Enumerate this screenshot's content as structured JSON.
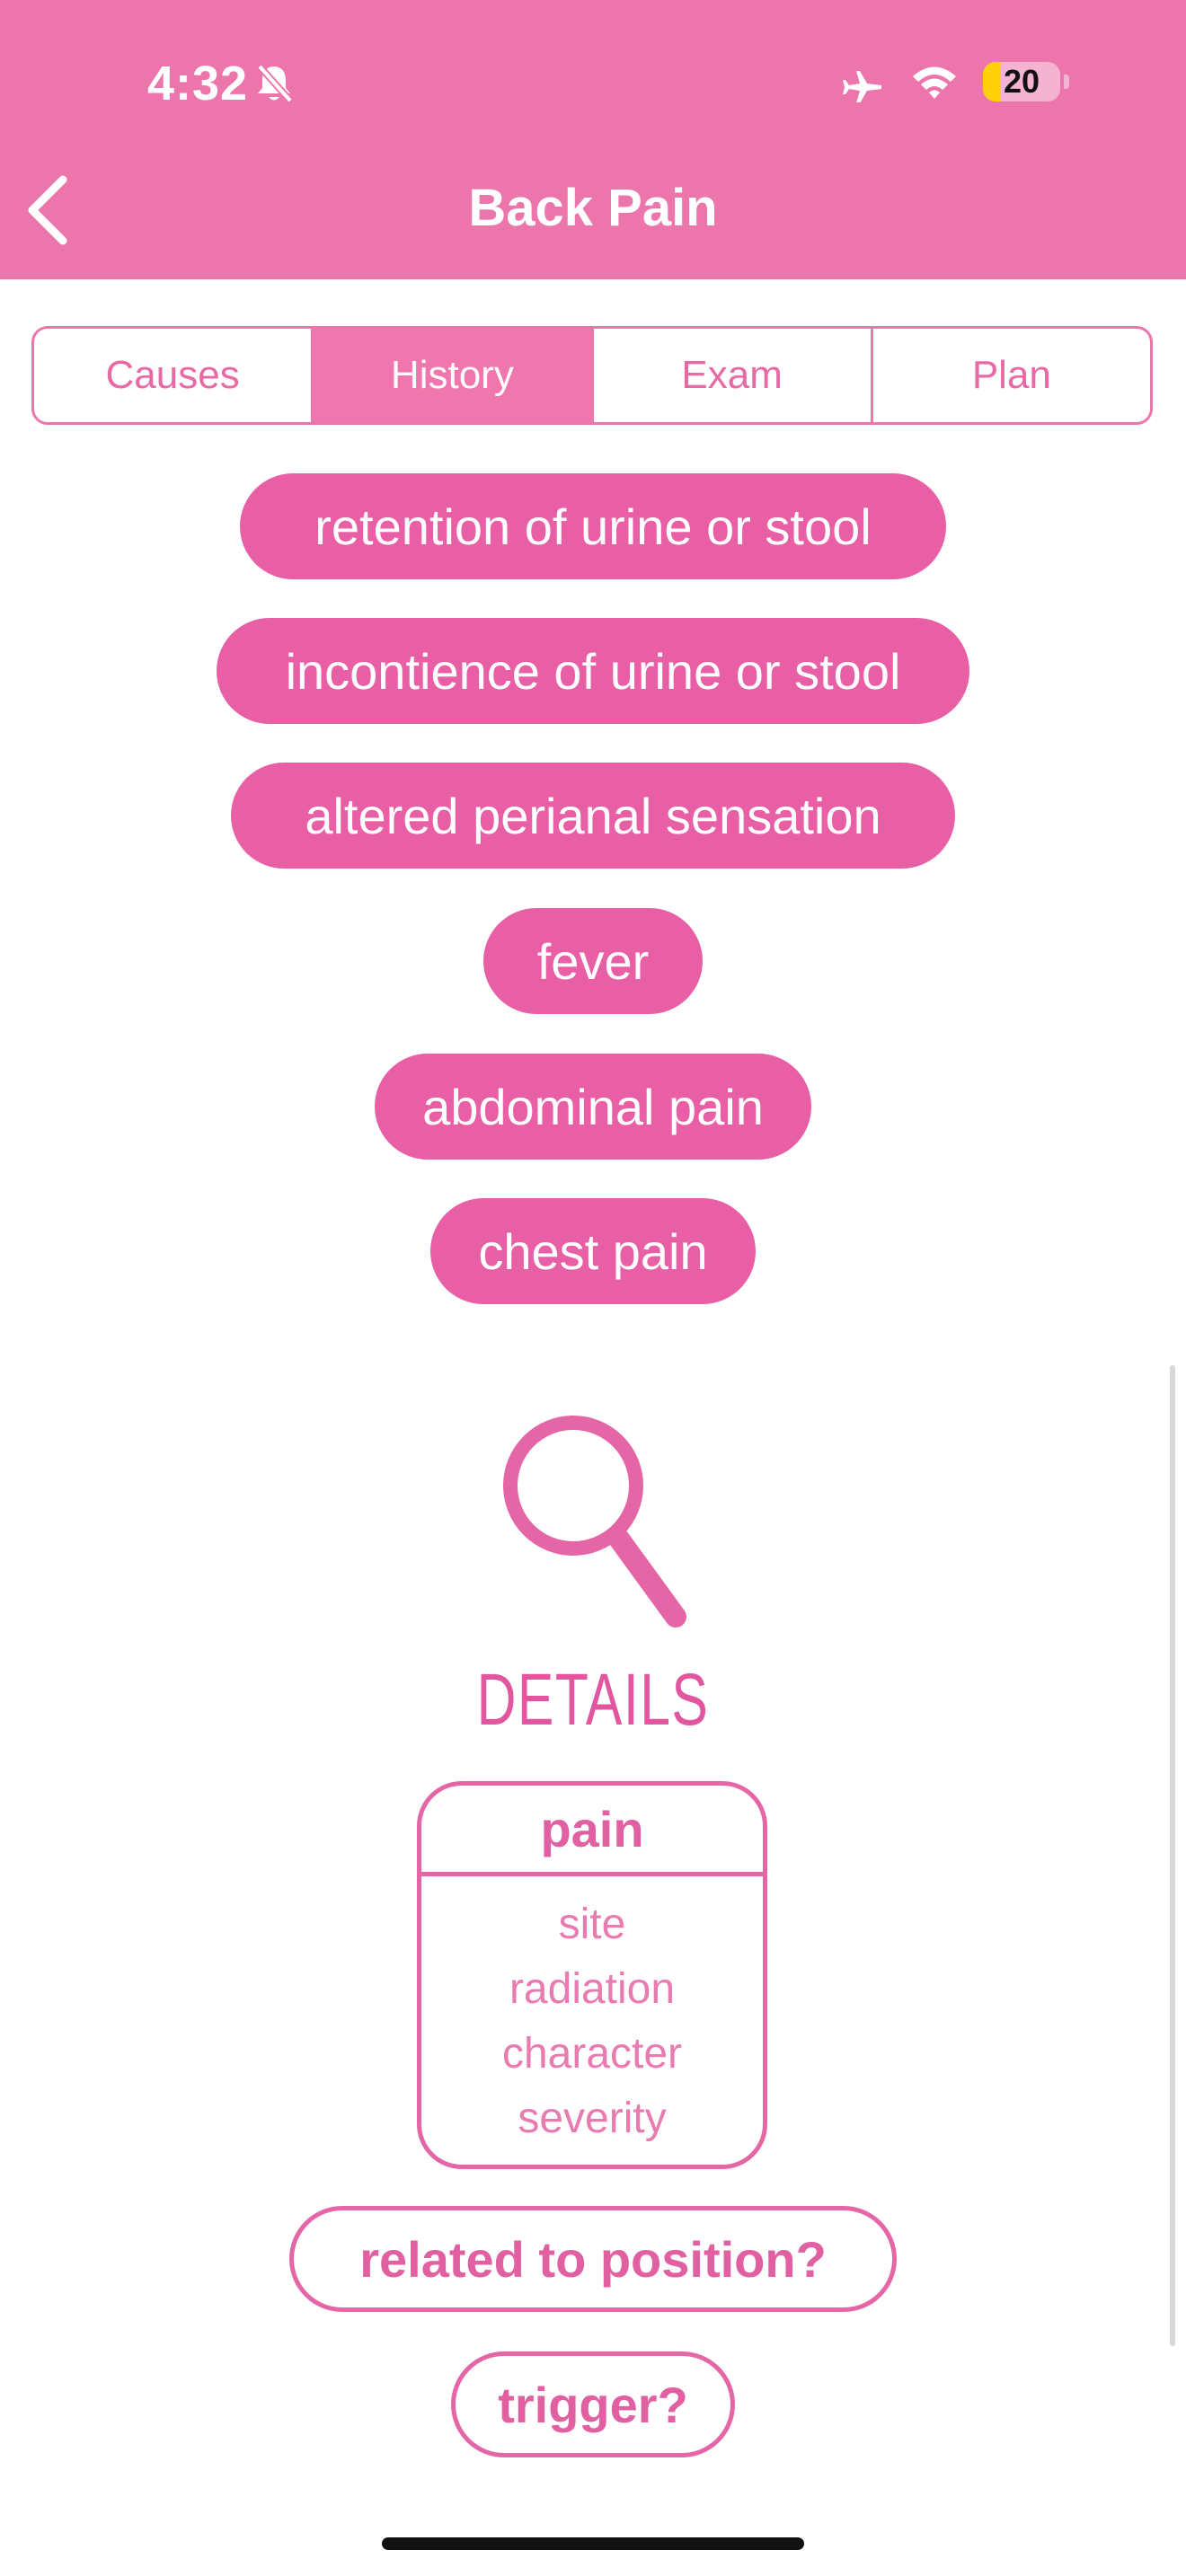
{
  "status_bar": {
    "time": "4:32",
    "battery": "20"
  },
  "header": {
    "title": "Back Pain"
  },
  "tabs": [
    {
      "label": "Causes"
    },
    {
      "label": "History",
      "active": true
    },
    {
      "label": "Exam"
    },
    {
      "label": "Plan"
    }
  ],
  "symptoms": [
    "retention of urine or stool",
    "incontience of urine or stool",
    "altered perianal sensation",
    "fever",
    "abdominal pain",
    "chest pain"
  ],
  "details": {
    "heading": "DETAILS",
    "card": {
      "title": "pain",
      "items": [
        "site",
        "radiation",
        "character",
        "severity"
      ]
    },
    "questions": [
      "related to position?",
      "trigger?"
    ]
  },
  "colors": {
    "brand": "#ec75ac",
    "pill": "#e85fa5",
    "accent_text": "#e060a2"
  }
}
